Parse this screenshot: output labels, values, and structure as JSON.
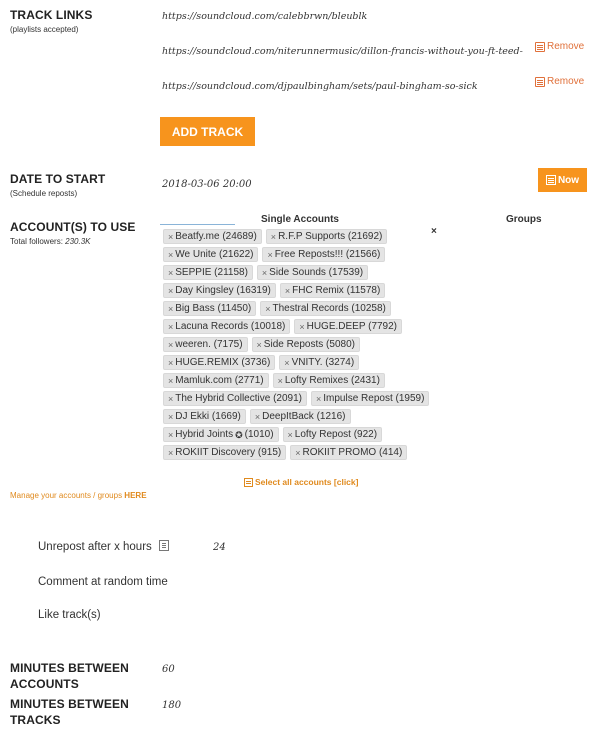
{
  "track_links": {
    "title": "TRACK LINKS",
    "subtitle": "(playlists accepted)",
    "links": [
      "https://soundcloud.com/calebbrwn/bleublk",
      "https://soundcloud.com/niterunnermusic/dillon-francis-without-you-ft-teed-",
      "https://soundcloud.com/djpaulbingham/sets/paul-bingham-so-sick"
    ],
    "remove_label": "Remove",
    "add_button": "ADD TRACK"
  },
  "date_to_start": {
    "title": "DATE TO START",
    "subtitle": "(Schedule reposts)",
    "value": "2018-03-06 20:00",
    "now_button": "Now"
  },
  "accounts": {
    "title": "ACCOUNT(S) TO USE",
    "followers_label": "Total followers:",
    "followers_value": "230.3K",
    "single_header": "Single Accounts",
    "groups_header": "Groups",
    "clear_all": "×",
    "tags": [
      "Beatfy.me (24689)",
      "R.F.P Supports (21692)",
      "We Unite (21622)",
      "Free Reposts!!! (21566)",
      "SEPPIE (21158)",
      "Side Sounds (17539)",
      "Day Kingsley (16319)",
      "FHC Remix (11578)",
      "Big Bass (11450)",
      "Thestral Records (10258)",
      "Lacuna Records (10018)",
      "HUGE.DEEP (7792)",
      "weeren. (7175)",
      "Side Reposts (5080)",
      "HUGE.REMIX (3736)",
      "VNITY. (3274)",
      "Mamluk.com (2771)",
      "Lofty Remixes (2431)",
      "The Hybrid Collective (2091)",
      "Impulse Repost (1959)",
      "DJ Ekki (1669)",
      "DeepItBack (1216)",
      "Hybrid Joints",
      "Lofty Repost (922)",
      "ROKIIT Discovery (915)",
      "ROKIIT PROMO (414)"
    ],
    "hybrid_joints_suffix": "(1010)",
    "select_all": "Select all accounts [click]",
    "manage_text": "Manage your accounts / groups ",
    "manage_link": "HERE"
  },
  "options": {
    "unrepost_label": "Unrepost after x hours",
    "unrepost_value": "24",
    "comment_label": "Comment at random time",
    "like_label": "Like track(s)"
  },
  "minutes_accounts": {
    "title_line1": "MINUTES BETWEEN",
    "title_line2": "ACCOUNTS",
    "value": "60"
  },
  "minutes_tracks": {
    "title_line1": "MINUTES BETWEEN",
    "title_line2": "TRACKS",
    "value": "180"
  },
  "colors": {
    "accent": "#f7941d",
    "remove": "#e0703a"
  }
}
